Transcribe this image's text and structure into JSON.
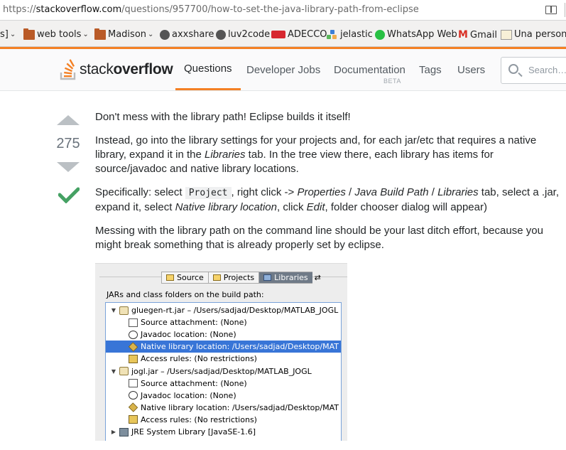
{
  "browser": {
    "url_prefix": "https://",
    "url_domain": "stackoverflow.com",
    "url_path": "/questions/957700/how-to-set-the-java-library-path-from-eclipse"
  },
  "bookmarks": [
    {
      "label": "s]",
      "chevron": "⌄"
    },
    {
      "label": "web tools",
      "icon": "folder-icon",
      "chevron": "⌄"
    },
    {
      "label": "Madison",
      "icon": "folder-icon",
      "chevron": "⌄"
    },
    {
      "label": "axxshare",
      "icon": "globe-icon"
    },
    {
      "label": "luv2code",
      "icon": "globe-icon"
    },
    {
      "label": "ADECCO",
      "icon": "adecco-icon"
    },
    {
      "label": "jelastic",
      "icon": "jelastic-icon"
    },
    {
      "label": "WhatsApp Web",
      "icon": "whatsapp-icon"
    },
    {
      "label": "Gmail",
      "icon": "gmail-icon"
    },
    {
      "label": "Una persona",
      "icon": "bookmark-icon"
    }
  ],
  "header": {
    "logo_light": "stack",
    "logo_bold": "overflow",
    "nav": [
      "Questions",
      "Developer Jobs",
      "Documentation",
      "Tags",
      "Users"
    ],
    "documentation_badge": "BETA",
    "search_placeholder": "Search…",
    "accent": "#f48024"
  },
  "answer": {
    "vote_count": "275",
    "accepted_color": "#45a163",
    "p1": "Don't mess with the library path! Eclipse builds it itself!",
    "p2_a": "Instead, go into the library settings for your projects and, for each jar/etc that requires a native library, expand it in the ",
    "p2_em": "Libraries",
    "p2_b": " tab. In the tree view there, each library has items for source/javadoc and native library locations.",
    "p3_a": "Specifically: select ",
    "p3_code": "Project",
    "p3_b": ", right click -> ",
    "p3_em1": "Properties",
    "p3_c": " / ",
    "p3_em2": "Java Build Path",
    "p3_d": " / ",
    "p3_em3": "Libraries",
    "p3_e": " tab, select a .jar, expand it, select ",
    "p3_em4": "Native library location",
    "p3_f": ", click ",
    "p3_em5": "Edit",
    "p3_g": ", folder chooser dialog will appear)",
    "p4": "Messing with the library path on the command line should be your last ditch effort, because you might break something that is already properly set by eclipse."
  },
  "screenshot": {
    "tabs": [
      "Source",
      "Projects",
      "Libraries",
      "⇄"
    ],
    "selected_tab": "Libraries",
    "label": "JARs and class folders on the build path:",
    "rows": [
      {
        "twisty": "▼",
        "icon": "jar",
        "text": "gluegen-rt.jar – /Users/sadjad/Desktop/MATLAB_JOGL"
      },
      {
        "twisty": "",
        "icon": "src",
        "text": "Source attachment: (None)"
      },
      {
        "twisty": "",
        "icon": "at",
        "text": "Javadoc location: (None)"
      },
      {
        "twisty": "",
        "icon": "nat",
        "text": "Native library location: /Users/sadjad/Desktop/MAT"
      },
      {
        "twisty": "",
        "icon": "acc",
        "text": "Access rules: (No restrictions)"
      },
      {
        "twisty": "▼",
        "icon": "jar",
        "text": "jogl.jar – /Users/sadjad/Desktop/MATLAB_JOGL"
      },
      {
        "twisty": "",
        "icon": "src",
        "text": "Source attachment: (None)"
      },
      {
        "twisty": "",
        "icon": "at",
        "text": "Javadoc location: (None)"
      },
      {
        "twisty": "",
        "icon": "nat",
        "text": "Native library location: /Users/sadjad/Desktop/MAT"
      },
      {
        "twisty": "",
        "icon": "acc",
        "text": "Access rules: (No restrictions)"
      },
      {
        "twisty": "▶",
        "icon": "lib",
        "text": "JRE System Library [JavaSE-1.6]"
      }
    ],
    "highlight_index": 3
  }
}
